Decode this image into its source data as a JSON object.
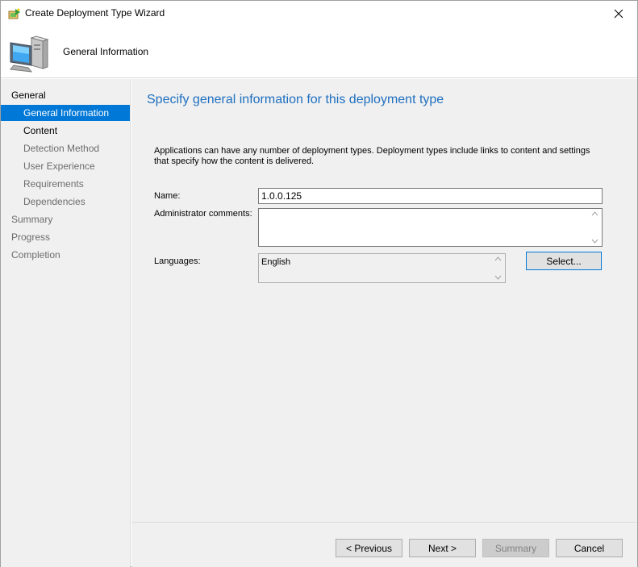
{
  "window": {
    "title": "Create Deployment Type Wizard",
    "close_glyph": "✕"
  },
  "banner": {
    "title": "General Information",
    "icon": "computer-icon"
  },
  "nav": {
    "items": [
      {
        "label": "General",
        "level": 0,
        "state": "active-section"
      },
      {
        "label": "General Information",
        "level": 1,
        "state": "selected"
      },
      {
        "label": "Content",
        "level": 1,
        "state": "normal"
      },
      {
        "label": "Detection Method",
        "level": 1,
        "state": "dim"
      },
      {
        "label": "User Experience",
        "level": 1,
        "state": "dim"
      },
      {
        "label": "Requirements",
        "level": 1,
        "state": "dim"
      },
      {
        "label": "Dependencies",
        "level": 1,
        "state": "dim"
      },
      {
        "label": "Summary",
        "level": 0,
        "state": "dim"
      },
      {
        "label": "Progress",
        "level": 0,
        "state": "dim"
      },
      {
        "label": "Completion",
        "level": 0,
        "state": "dim"
      }
    ]
  },
  "main": {
    "heading": "Specify general information for this deployment type",
    "description": "Applications can have any number of deployment types. Deployment types include links to content and settings that specify how the content is delivered.",
    "name_label": "Name:",
    "name_value": "1.0.0.125",
    "admin_comments_label": "Administrator comments:",
    "admin_comments_value": "",
    "languages_label": "Languages:",
    "languages": [
      "English"
    ],
    "select_button": "Select..."
  },
  "footer": {
    "previous_button": "< Previous",
    "next_button": "Next >",
    "summary_button": "Summary",
    "cancel_button": "Cancel"
  },
  "colors": {
    "accent": "#0078d7",
    "heading": "#1e6fc0",
    "panel_bg": "#f0f0f0"
  }
}
